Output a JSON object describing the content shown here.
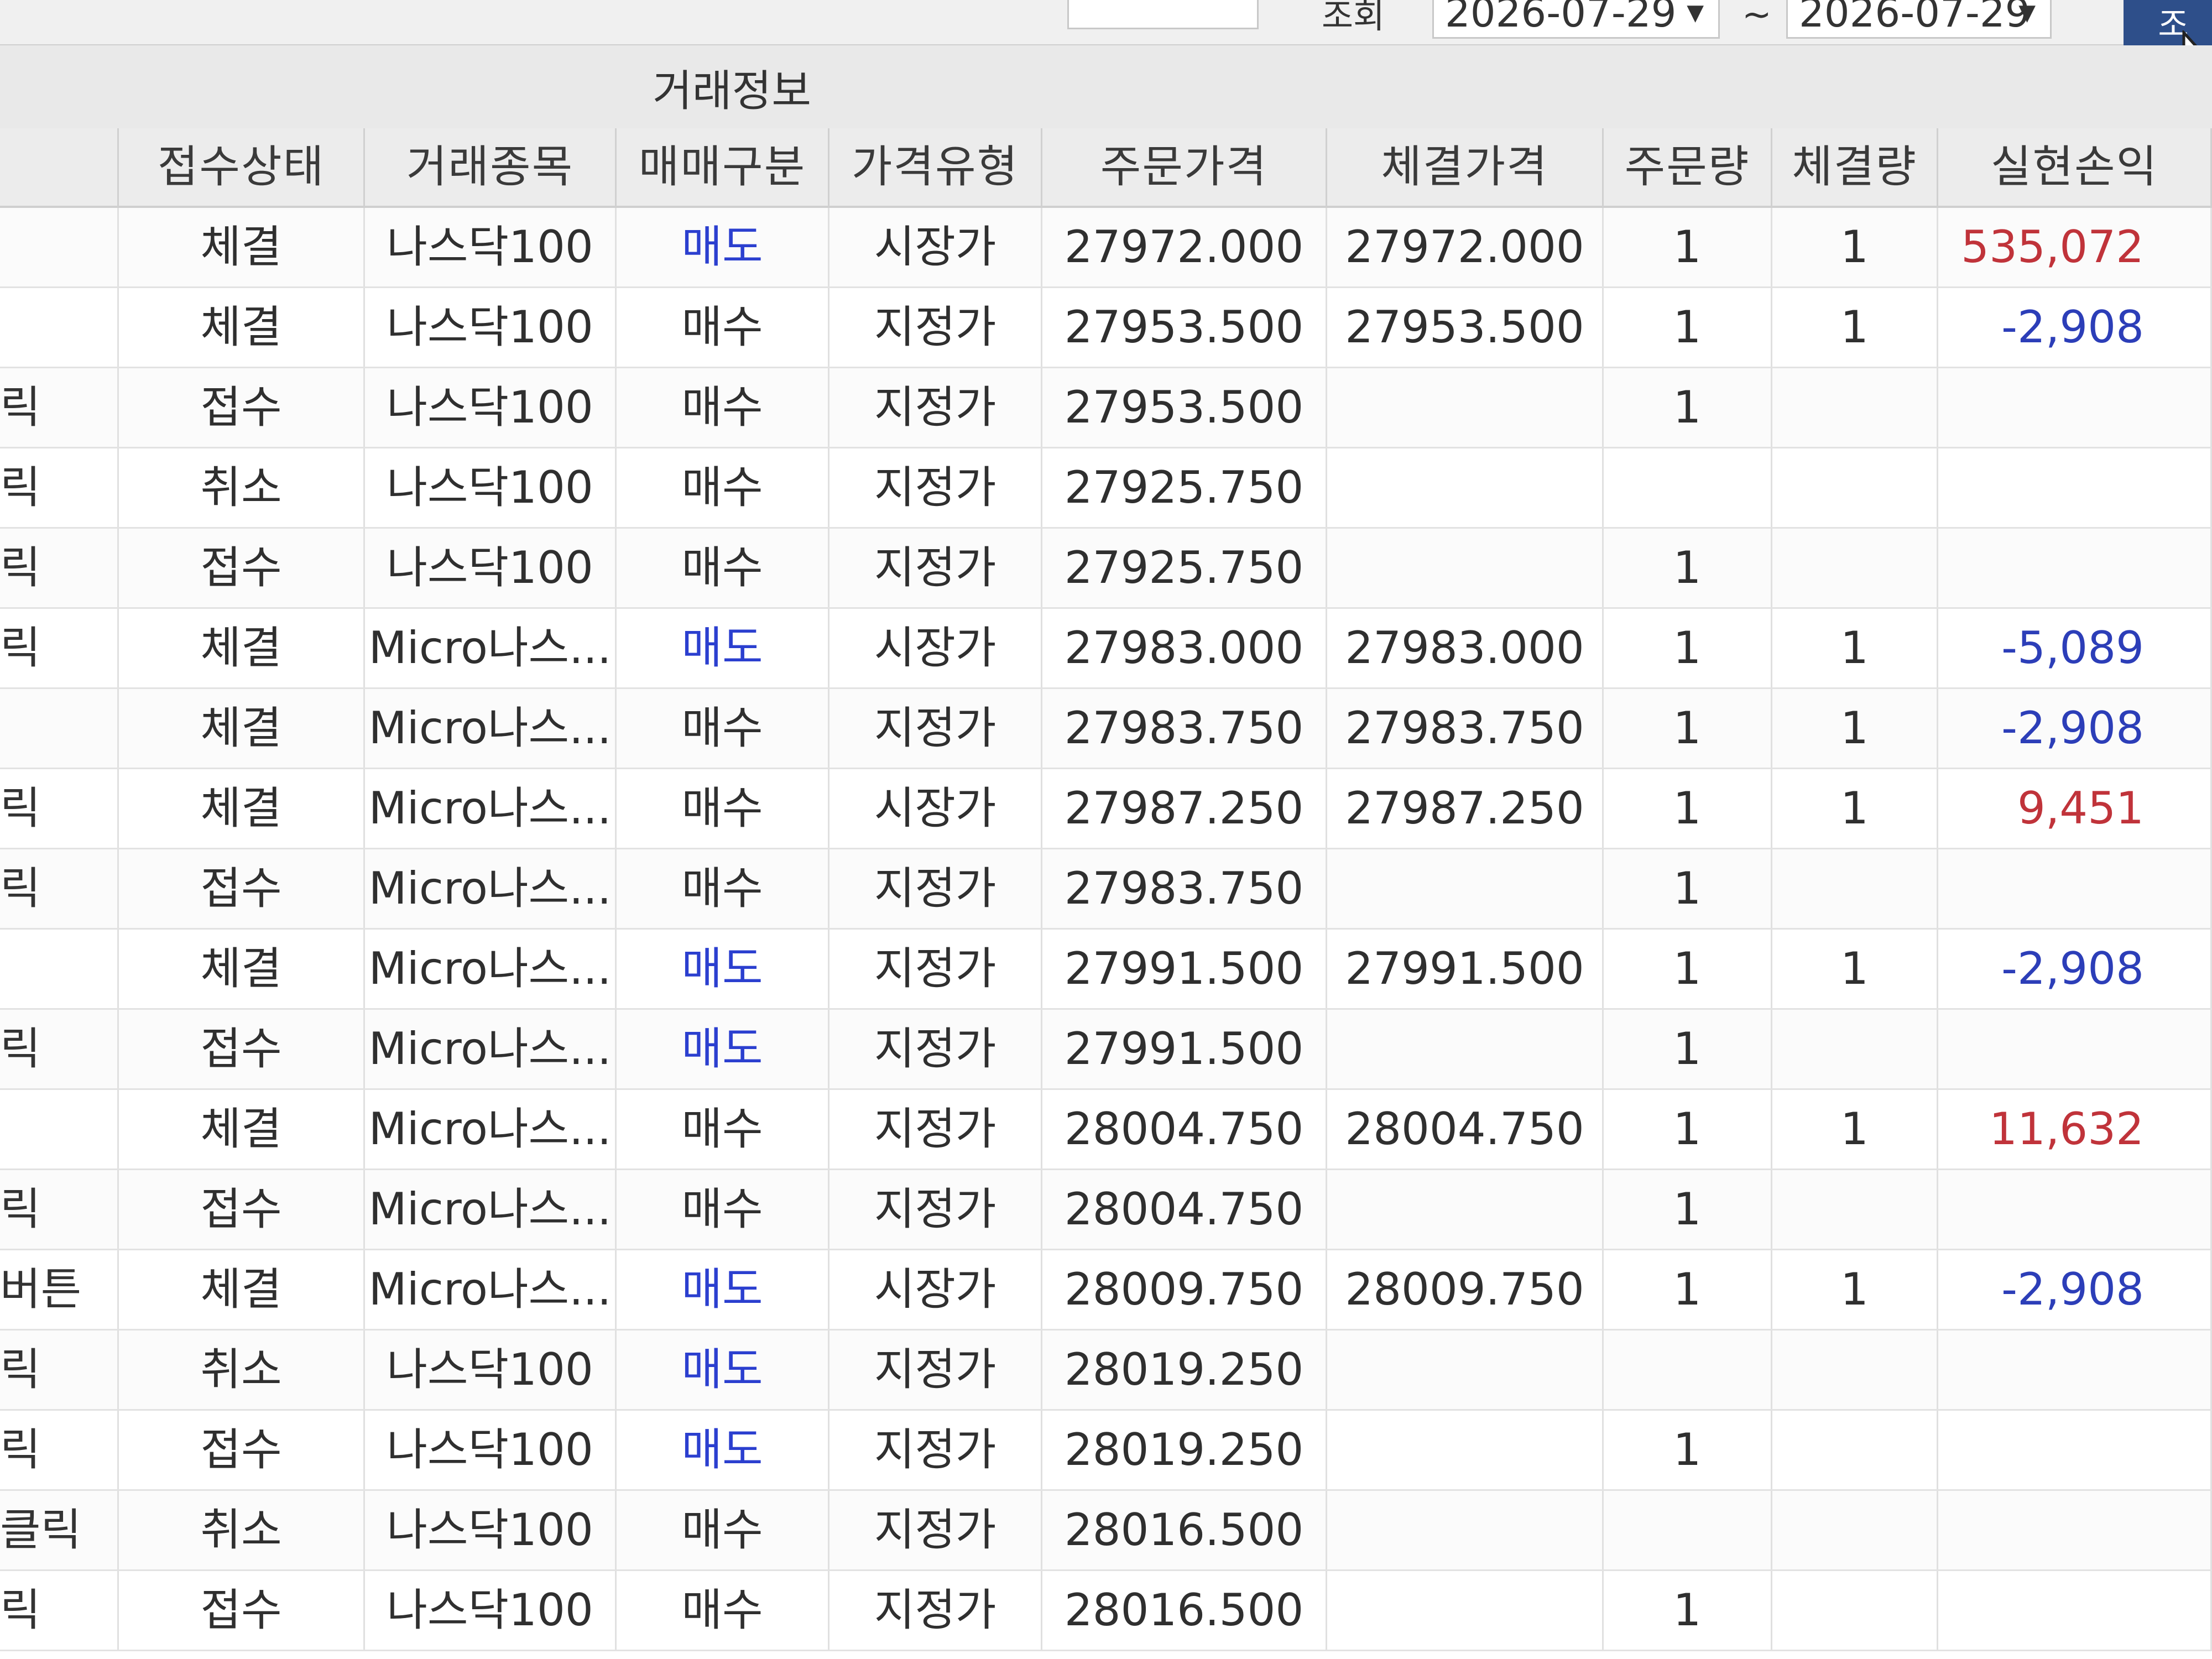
{
  "filter": {
    "date_label": "조회",
    "date_from": "2026-07-29",
    "tilde": "~",
    "date_to": "2026-07-29",
    "search_button": "조"
  },
  "grid": {
    "group_title": "거래정보",
    "headers": {
      "status": "접수상태",
      "item": "거래종목",
      "side": "매매구분",
      "price_type": "가격유형",
      "order_price": "주문가격",
      "fill_price": "체결가격",
      "order_qty": "주문량",
      "fill_qty": "체결량",
      "pnl": "실현손익"
    },
    "rows": [
      {
        "left": "",
        "status": "체결",
        "item": "나스닥100",
        "side": "매도",
        "side_type": "sell",
        "price_type": "시장가",
        "order_price": "27972.000",
        "fill_price": "27972.000",
        "order_qty": "1",
        "fill_qty": "1",
        "pnl": "535,072",
        "pnl_sign": "pos"
      },
      {
        "left": "",
        "status": "체결",
        "item": "나스닥100",
        "side": "매수",
        "side_type": "buy",
        "price_type": "지정가",
        "order_price": "27953.500",
        "fill_price": "27953.500",
        "order_qty": "1",
        "fill_qty": "1",
        "pnl": "-2,908",
        "pnl_sign": "neg"
      },
      {
        "left": "릭",
        "status": "접수",
        "item": "나스닥100",
        "side": "매수",
        "side_type": "buy",
        "price_type": "지정가",
        "order_price": "27953.500",
        "fill_price": "",
        "order_qty": "1",
        "fill_qty": "",
        "pnl": "",
        "pnl_sign": ""
      },
      {
        "left": "릭",
        "status": "취소",
        "item": "나스닥100",
        "side": "매수",
        "side_type": "buy",
        "price_type": "지정가",
        "order_price": "27925.750",
        "fill_price": "",
        "order_qty": "",
        "fill_qty": "",
        "pnl": "",
        "pnl_sign": ""
      },
      {
        "left": "릭",
        "status": "접수",
        "item": "나스닥100",
        "side": "매수",
        "side_type": "buy",
        "price_type": "지정가",
        "order_price": "27925.750",
        "fill_price": "",
        "order_qty": "1",
        "fill_qty": "",
        "pnl": "",
        "pnl_sign": ""
      },
      {
        "left": "릭",
        "status": "체결",
        "item": "Micro나스...",
        "side": "매도",
        "side_type": "sell",
        "price_type": "시장가",
        "order_price": "27983.000",
        "fill_price": "27983.000",
        "order_qty": "1",
        "fill_qty": "1",
        "pnl": "-5,089",
        "pnl_sign": "neg"
      },
      {
        "left": "",
        "status": "체결",
        "item": "Micro나스...",
        "side": "매수",
        "side_type": "buy",
        "price_type": "지정가",
        "order_price": "27983.750",
        "fill_price": "27983.750",
        "order_qty": "1",
        "fill_qty": "1",
        "pnl": "-2,908",
        "pnl_sign": "neg"
      },
      {
        "left": "릭",
        "status": "체결",
        "item": "Micro나스...",
        "side": "매수",
        "side_type": "buy",
        "price_type": "시장가",
        "order_price": "27987.250",
        "fill_price": "27987.250",
        "order_qty": "1",
        "fill_qty": "1",
        "pnl": "9,451",
        "pnl_sign": "pos"
      },
      {
        "left": "릭",
        "status": "접수",
        "item": "Micro나스...",
        "side": "매수",
        "side_type": "buy",
        "price_type": "지정가",
        "order_price": "27983.750",
        "fill_price": "",
        "order_qty": "1",
        "fill_qty": "",
        "pnl": "",
        "pnl_sign": ""
      },
      {
        "left": "",
        "status": "체결",
        "item": "Micro나스...",
        "side": "매도",
        "side_type": "sell",
        "price_type": "지정가",
        "order_price": "27991.500",
        "fill_price": "27991.500",
        "order_qty": "1",
        "fill_qty": "1",
        "pnl": "-2,908",
        "pnl_sign": "neg"
      },
      {
        "left": "릭",
        "status": "접수",
        "item": "Micro나스...",
        "side": "매도",
        "side_type": "sell",
        "price_type": "지정가",
        "order_price": "27991.500",
        "fill_price": "",
        "order_qty": "1",
        "fill_qty": "",
        "pnl": "",
        "pnl_sign": ""
      },
      {
        "left": "",
        "status": "체결",
        "item": "Micro나스...",
        "side": "매수",
        "side_type": "buy",
        "price_type": "지정가",
        "order_price": "28004.750",
        "fill_price": "28004.750",
        "order_qty": "1",
        "fill_qty": "1",
        "pnl": "11,632",
        "pnl_sign": "pos"
      },
      {
        "left": "릭",
        "status": "접수",
        "item": "Micro나스...",
        "side": "매수",
        "side_type": "buy",
        "price_type": "지정가",
        "order_price": "28004.750",
        "fill_price": "",
        "order_qty": "1",
        "fill_qty": "",
        "pnl": "",
        "pnl_sign": ""
      },
      {
        "left": "버튼",
        "status": "체결",
        "item": "Micro나스...",
        "side": "매도",
        "side_type": "sell",
        "price_type": "시장가",
        "order_price": "28009.750",
        "fill_price": "28009.750",
        "order_qty": "1",
        "fill_qty": "1",
        "pnl": "-2,908",
        "pnl_sign": "neg"
      },
      {
        "left": "릭",
        "status": "취소",
        "item": "나스닥100",
        "side": "매도",
        "side_type": "sell",
        "price_type": "지정가",
        "order_price": "28019.250",
        "fill_price": "",
        "order_qty": "",
        "fill_qty": "",
        "pnl": "",
        "pnl_sign": ""
      },
      {
        "left": "릭",
        "status": "접수",
        "item": "나스닥100",
        "side": "매도",
        "side_type": "sell",
        "price_type": "지정가",
        "order_price": "28019.250",
        "fill_price": "",
        "order_qty": "1",
        "fill_qty": "",
        "pnl": "",
        "pnl_sign": ""
      },
      {
        "left": "클릭",
        "status": "취소",
        "item": "나스닥100",
        "side": "매수",
        "side_type": "buy",
        "price_type": "지정가",
        "order_price": "28016.500",
        "fill_price": "",
        "order_qty": "",
        "fill_qty": "",
        "pnl": "",
        "pnl_sign": ""
      },
      {
        "left": "릭",
        "status": "접수",
        "item": "나스닥100",
        "side": "매수",
        "side_type": "buy",
        "price_type": "지정가",
        "order_price": "28016.500",
        "fill_price": "",
        "order_qty": "1",
        "fill_qty": "",
        "pnl": "",
        "pnl_sign": ""
      }
    ]
  },
  "colors": {
    "sell": "#2b3fcf",
    "profit": "#c0333a",
    "loss": "#2c3eb8",
    "search_button": "#2e4f8a"
  },
  "icons": {
    "dropdown": "caret-down-icon",
    "cursor": "mouse-pointer-icon"
  }
}
